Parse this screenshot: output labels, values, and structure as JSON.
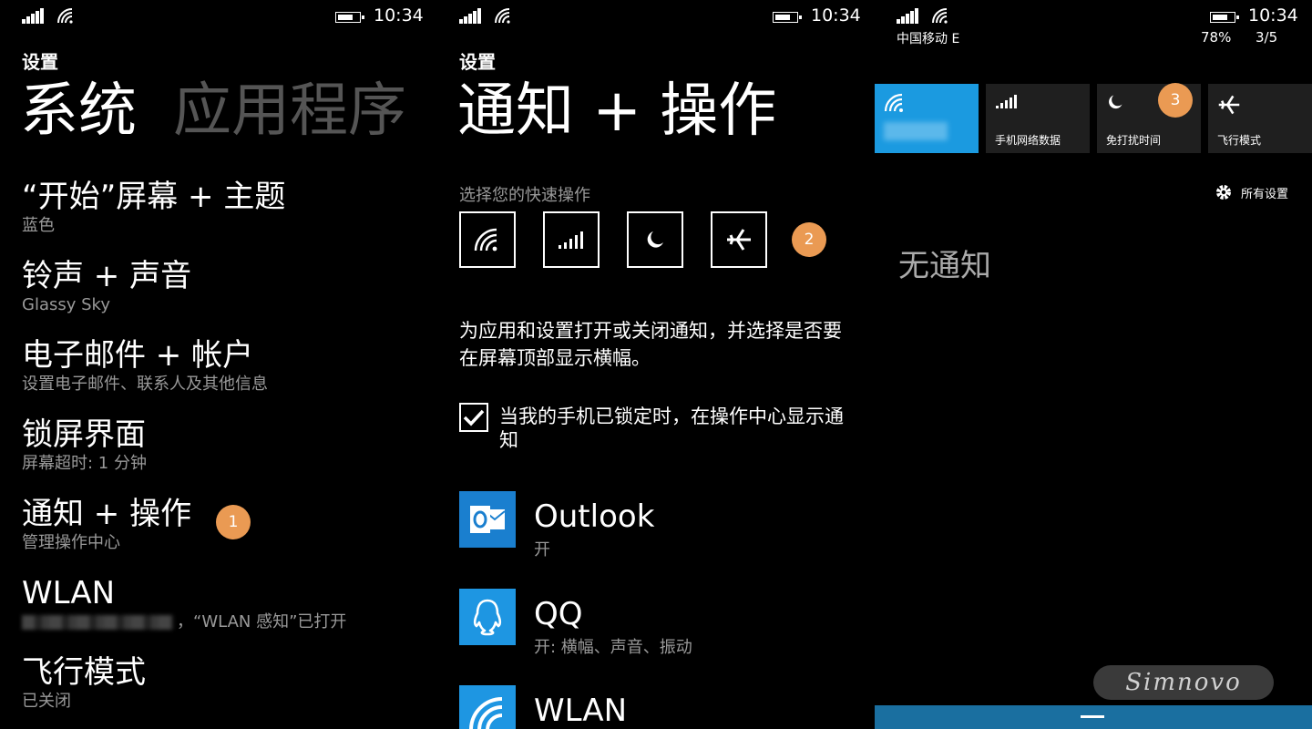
{
  "status": {
    "time": "10:34",
    "carrier": "中国移动 E",
    "battery_pct": "78%",
    "notif_count": "3/5"
  },
  "panel1": {
    "header": "设置",
    "pivot_active": "系统",
    "pivot_inactive": "应用程序",
    "items": [
      {
        "title": "“开始”屏幕 + 主题",
        "subtitle": "蓝色"
      },
      {
        "title": "铃声 + 声音",
        "subtitle": "Glassy Sky"
      },
      {
        "title": "电子邮件 + 帐户",
        "subtitle": "设置电子邮件、联系人及其他信息"
      },
      {
        "title": "锁屏界面",
        "subtitle": "屏幕超时: 1 分钟"
      },
      {
        "title": "通知 + 操作",
        "subtitle": "管理操作中心"
      },
      {
        "title": "WLAN",
        "subtitle": "，“WLAN 感知”已打开"
      },
      {
        "title": "飞行模式",
        "subtitle": "已关闭"
      }
    ],
    "badge": "1"
  },
  "panel2": {
    "header": "设置",
    "title": "通知 + 操作",
    "quick_label": "选择您的快速操作",
    "quick_actions": [
      "wifi-icon",
      "cellular-icon",
      "moon-icon",
      "airplane-icon"
    ],
    "badge": "2",
    "description": "为应用和设置打开或关闭通知，并选择是否要在屏幕顶部显示横幅。",
    "checkbox_label": "当我的手机已锁定时，在操作中心显示通知",
    "checkbox_checked": true,
    "apps": [
      {
        "name": "Outlook",
        "status": "开",
        "icon": "outlook-icon"
      },
      {
        "name": "QQ",
        "status": "开: 横幅、声音、振动",
        "icon": "qq-icon"
      },
      {
        "name": "WLAN",
        "status": "",
        "icon": "wifi-icon"
      }
    ]
  },
  "panel3": {
    "tiles": [
      {
        "label": "",
        "icon": "wifi-icon",
        "active": true
      },
      {
        "label": "手机网络数据",
        "icon": "cellular-icon",
        "active": false
      },
      {
        "label": "免打扰时间",
        "icon": "moon-icon",
        "active": false
      },
      {
        "label": "飞行模式",
        "icon": "airplane-icon",
        "active": false
      }
    ],
    "badge": "3",
    "all_settings": "所有设置",
    "empty_text": "无通知",
    "watermark": "Simnovo"
  },
  "colors": {
    "accent": "#1b9ae0",
    "badge": "#ea9a53",
    "tile": "#1f1f1f",
    "bottom_bar": "#1a6fa0"
  }
}
